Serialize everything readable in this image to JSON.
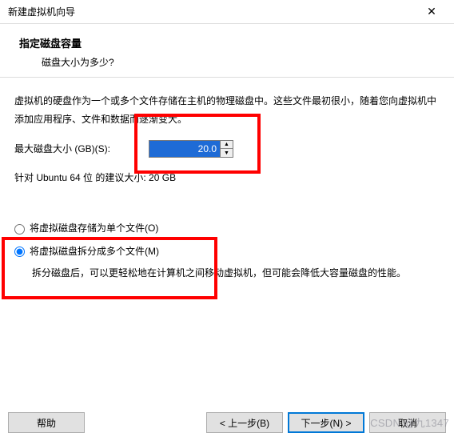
{
  "window": {
    "title": "新建虚拟机向导"
  },
  "header": {
    "title": "指定磁盘容量",
    "subtitle": "磁盘大小为多少?"
  },
  "content": {
    "description": "虚拟机的硬盘作为一个或多个文件存储在主机的物理磁盘中。这些文件最初很小，随着您向虚拟机中添加应用程序、文件和数据而逐渐变大。",
    "size_label": "最大磁盘大小 (GB)(S):",
    "size_value": "20.0",
    "recommendation": "针对 Ubuntu 64 位 的建议大小: 20 GB",
    "radio_single": "将虚拟磁盘存储为单个文件(O)",
    "radio_split": "将虚拟磁盘拆分成多个文件(M)",
    "split_desc": "拆分磁盘后，可以更轻松地在计算机之间移动虚拟机，但可能会降低大容量磁盘的性能。"
  },
  "footer": {
    "help": "帮助",
    "back": "< 上一步(B)",
    "next": "下一步(N) >",
    "cancel": "取消"
  },
  "watermark": "CSDN @九1347"
}
